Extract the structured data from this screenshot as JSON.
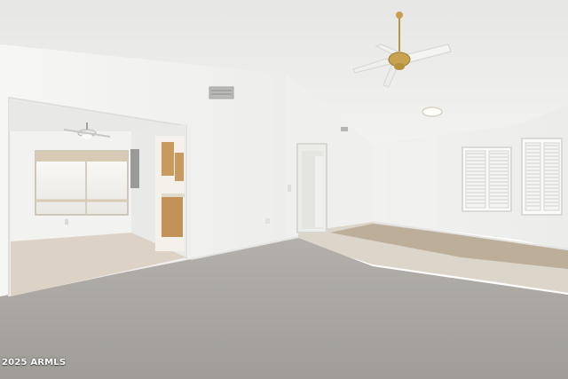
{
  "watermark": {
    "text": "2025 ARMLS"
  },
  "colors": {
    "ceiling": "#eeeeec",
    "wall": "#f3f3f2",
    "carpet": "#a8a5a0",
    "tile": "#d8d0c4",
    "carpet_rug": "#b8a994",
    "cabinet": "#c99a5e",
    "window_glow": "#f7f7f5"
  },
  "icons": [
    "ceiling-fan-icon",
    "ceiling-light-icon",
    "air-vent-icon",
    "window-shutters-icon"
  ]
}
